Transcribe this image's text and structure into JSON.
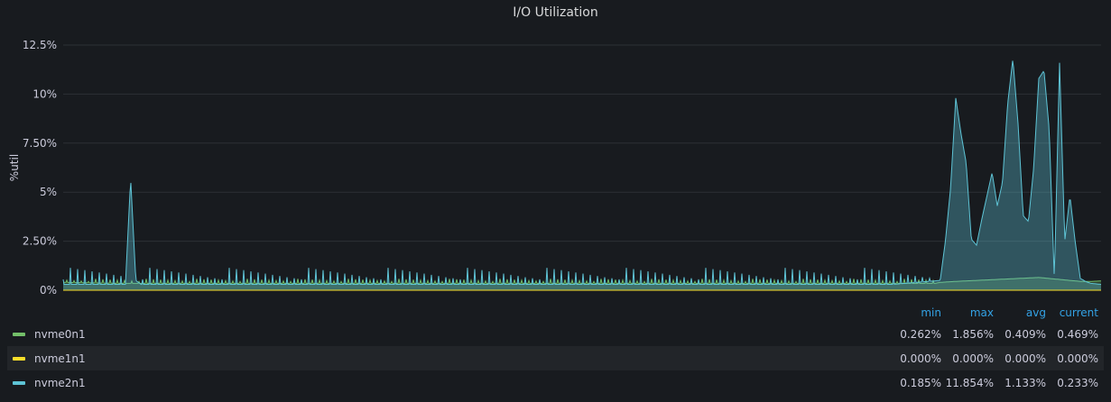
{
  "panel": {
    "title": "I/O Utilization"
  },
  "legend": {
    "headers": [
      "min",
      "max",
      "avg",
      "current"
    ],
    "rows": [
      {
        "name": "nvme0n1",
        "color": "#73bf69",
        "min": "0.262%",
        "max": "1.856%",
        "avg": "0.409%",
        "current": "0.469%"
      },
      {
        "name": "nvme1n1",
        "color": "#fade2a",
        "min": "0.000%",
        "max": "0.000%",
        "avg": "0.000%",
        "current": "0.000%"
      },
      {
        "name": "nvme2n1",
        "color": "#5ec4d6",
        "min": "0.185%",
        "max": "11.854%",
        "avg": "1.133%",
        "current": "0.233%"
      }
    ]
  },
  "chart_data": {
    "type": "area",
    "title": "I/O Utilization",
    "ylabel": "%util",
    "xlabel": "",
    "ylim": [
      0,
      12.5
    ],
    "yticks": [
      "0%",
      "2.50%",
      "5%",
      "7.50%",
      "10%",
      "12.5%"
    ],
    "ytick_values": [
      0,
      2.5,
      5,
      7.5,
      10,
      12.5
    ],
    "grid": true,
    "x_range": [
      0,
      1
    ],
    "series": [
      {
        "name": "nvme0n1",
        "color": "#73bf69",
        "x": [
          0,
          0.05,
          0.1,
          0.2,
          0.3,
          0.4,
          0.5,
          0.6,
          0.7,
          0.8,
          0.84,
          0.845,
          0.86,
          0.88,
          0.9,
          0.92,
          0.94,
          0.96,
          0.97,
          0.98,
          0.99,
          1.0
        ],
        "values": [
          0.4,
          0.35,
          0.35,
          0.35,
          0.35,
          0.35,
          0.35,
          0.35,
          0.35,
          0.35,
          0.35,
          0.4,
          0.45,
          0.5,
          0.55,
          0.6,
          0.65,
          0.55,
          0.5,
          0.45,
          0.45,
          0.47
        ]
      },
      {
        "name": "nvme1n1",
        "color": "#fade2a",
        "x": [
          0,
          1
        ],
        "values": [
          0,
          0
        ]
      },
      {
        "name": "nvme2n1",
        "color": "#5ec4d6",
        "x": [
          0,
          0.06,
          0.065,
          0.07,
          0.075,
          0.08,
          0.2,
          0.4,
          0.6,
          0.8,
          0.845,
          0.85,
          0.855,
          0.86,
          0.865,
          0.87,
          0.875,
          0.88,
          0.885,
          0.89,
          0.895,
          0.9,
          0.905,
          0.91,
          0.915,
          0.92,
          0.925,
          0.93,
          0.935,
          0.94,
          0.945,
          0.95,
          0.955,
          0.96,
          0.965,
          0.97,
          0.975,
          0.98,
          0.985,
          0.99,
          1.0
        ],
        "values": [
          0.3,
          0.3,
          5.7,
          0.5,
          0.3,
          0.3,
          0.3,
          0.3,
          0.3,
          0.3,
          0.5,
          2.5,
          5.2,
          9.8,
          8.0,
          6.5,
          2.6,
          2.3,
          3.6,
          4.8,
          6.0,
          4.3,
          5.5,
          9.5,
          11.8,
          8.5,
          3.8,
          3.5,
          6.2,
          10.8,
          11.2,
          8.2,
          0.5,
          11.6,
          2.5,
          4.8,
          2.5,
          0.6,
          0.45,
          0.35,
          0.3
        ]
      }
    ]
  }
}
